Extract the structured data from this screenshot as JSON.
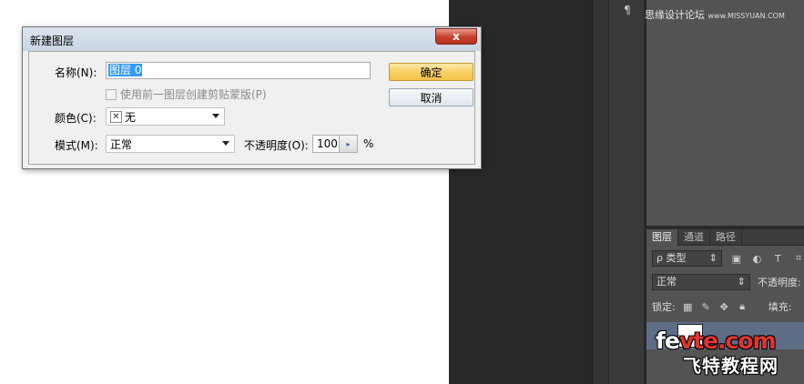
{
  "dialog": {
    "title": "新建图层",
    "close_glyph": "x",
    "name_label": "名称(N):",
    "name_value": "图层 0",
    "clip_checkbox_label": "使用前一图层创建剪贴蒙版(P)",
    "clip_checked": false,
    "color_label": "颜色(C):",
    "color_value": "无",
    "mode_label": "模式(M):",
    "mode_value": "正常",
    "opacity_label": "不透明度(O):",
    "opacity_value": "100",
    "opacity_unit": "%",
    "ok_label": "确定",
    "cancel_label": "取消"
  },
  "workspace": {
    "paragraph_glyph": "¶",
    "watermark_text": "思缘设计论坛",
    "watermark_url": "www.MISSYUAN.COM"
  },
  "layers_panel": {
    "tabs": [
      "图层",
      "通道",
      "路径"
    ],
    "filter_label": "ρ 类型",
    "blend_mode": "正常",
    "opacity_label": "不透明度:",
    "lock_label": "锁定:",
    "fill_label": "填充:"
  },
  "brand": {
    "logo_part1": "fe",
    "logo_part2": "vte.com",
    "logo_cn": "飞特教程网"
  },
  "colors": {
    "workspace_bg": "#282828",
    "panel_bg": "#535353",
    "ok_button": "#f7cf62",
    "close_button": "#c7402b",
    "selection": "#3399ff"
  }
}
